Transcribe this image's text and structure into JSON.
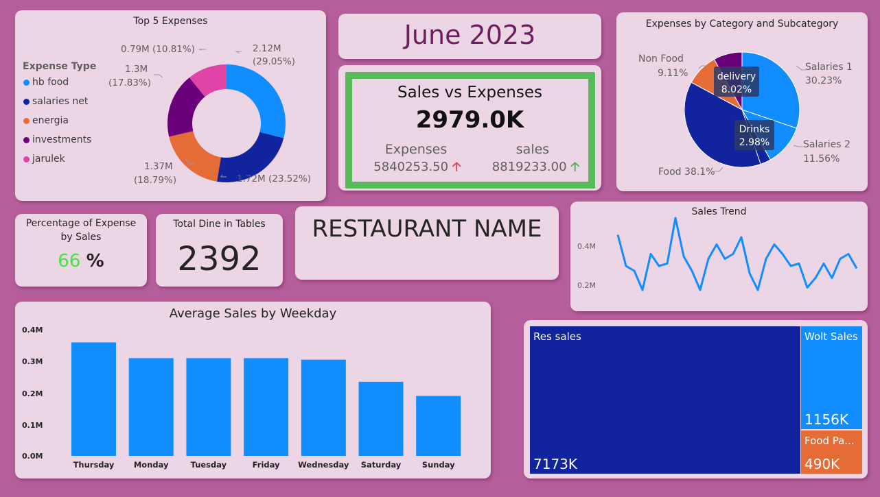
{
  "top5": {
    "title": "Top 5 Expenses",
    "legend_title": "Expense Type",
    "legend": [
      {
        "label": "hb food",
        "color": "#118dff"
      },
      {
        "label": "salaries net",
        "color": "#12239e"
      },
      {
        "label": "energia",
        "color": "#e66c37"
      },
      {
        "label": "investments",
        "color": "#6b007b"
      },
      {
        "label": "jarulek",
        "color": "#e044a7"
      }
    ],
    "slices": [
      {
        "value": 2.12,
        "pct": 29.05,
        "color": "#118dff",
        "label1": "2.12M",
        "label2": "(29.05%)"
      },
      {
        "value": 1.72,
        "pct": 23.52,
        "color": "#12239e",
        "label1": "1.72M (23.52%)",
        "label2": ""
      },
      {
        "value": 1.37,
        "pct": 18.79,
        "color": "#e66c37",
        "label1": "1.37M",
        "label2": "(18.79%)"
      },
      {
        "value": 1.3,
        "pct": 17.83,
        "color": "#6b007b",
        "label1": "1.3M",
        "label2": "(17.83%)"
      },
      {
        "value": 0.79,
        "pct": 10.81,
        "color": "#e044a7",
        "label1": "0.79M (10.81%)",
        "label2": ""
      }
    ]
  },
  "month": {
    "title": "June 2023"
  },
  "kpi": {
    "title": "Sales vs Expenses",
    "value": "2979.0K",
    "expenses_label": "Expenses",
    "expenses_value": "5840253.50",
    "sales_label": "sales",
    "sales_value": "8819233.00"
  },
  "category": {
    "title": "Expenses by Category and Subcategory",
    "slices": [
      {
        "name": "Salaries 1",
        "pct": 30.23,
        "value": "30.23%",
        "color": "#118dff"
      },
      {
        "name": "Salaries 2",
        "pct": 11.56,
        "value": "11.56%",
        "color": "#118dff"
      },
      {
        "name": "Drinks",
        "pct": 2.98,
        "value": "2.98%",
        "color": "#12239e"
      },
      {
        "name": "Food",
        "pct": 38.1,
        "value": "38.1%",
        "color": "#12239e"
      },
      {
        "name": "Non Food",
        "pct": 9.11,
        "value": "9.11%",
        "color": "#e66c37"
      },
      {
        "name": "delivery",
        "pct": 8.02,
        "value": "8.02%",
        "color": "#6b007b"
      }
    ]
  },
  "pct_expense": {
    "title_line1": "Percentage of Expense",
    "title_line2": "by Sales",
    "value": "66",
    "unit": "%"
  },
  "dine_in": {
    "title": "Total Dine in Tables",
    "value": "2392"
  },
  "restaurant": {
    "name": "RESTAURANT NAME"
  },
  "trend": {
    "title": "Sales Trend",
    "y_ticks": [
      "0.4M",
      "0.2M"
    ],
    "chart_data": {
      "type": "line",
      "ylim": [
        0.1,
        0.5
      ],
      "values": [
        0.41,
        0.28,
        0.26,
        0.18,
        0.33,
        0.28,
        0.29,
        0.48,
        0.32,
        0.26,
        0.18,
        0.31,
        0.37,
        0.31,
        0.33,
        0.4,
        0.25,
        0.18,
        0.31,
        0.37,
        0.33,
        0.28,
        0.29,
        0.19,
        0.23,
        0.29,
        0.23,
        0.31,
        0.33,
        0.27
      ]
    }
  },
  "weekday": {
    "title": "Average Sales by Weekday",
    "y_ticks": [
      "0.4M",
      "0.3M",
      "0.2M",
      "0.1M",
      "0.0M"
    ],
    "chart_data": {
      "type": "bar",
      "categories": [
        "Thursday",
        "Monday",
        "Tuesday",
        "Friday",
        "Wednesday",
        "Saturday",
        "Sunday"
      ],
      "values": [
        0.36,
        0.31,
        0.31,
        0.31,
        0.305,
        0.235,
        0.19
      ],
      "ylim": [
        0,
        0.4
      ],
      "color": "#118dff"
    }
  },
  "treemap": {
    "items": [
      {
        "label": "Res sales",
        "value": "7173K",
        "color": "#12239e"
      },
      {
        "label": "Wolt Sales",
        "value": "1156K",
        "color": "#118dff"
      },
      {
        "label": "Food Pa...",
        "value": "490K",
        "color": "#e66c37"
      }
    ]
  }
}
